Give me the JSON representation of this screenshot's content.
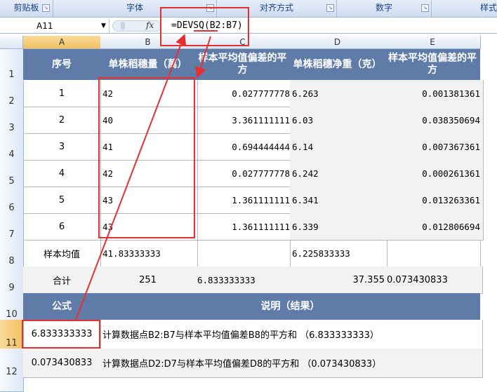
{
  "ribbon": {
    "groups": [
      "剪贴板",
      "字体",
      "对齐方式",
      "数字",
      "样式"
    ]
  },
  "formula_bar": {
    "name_box": "A11",
    "fx_label": "fx",
    "formula": "=DEVSQ(B2:B7)"
  },
  "columns": [
    "A",
    "B",
    "C",
    "D",
    "E"
  ],
  "rows": [
    "1",
    "2",
    "3",
    "4",
    "5",
    "6",
    "7",
    "8",
    "9",
    "10",
    "11",
    "12"
  ],
  "table": {
    "headers": [
      "序号",
      "单株稻穗量（萬）",
      "样本平均值偏差的平方",
      "单株稻穗净重（克）",
      "样本平均值偏差的平方"
    ],
    "data": [
      [
        "1",
        "42",
        "0.027777778",
        "6.263",
        "0.001381361"
      ],
      [
        "2",
        "40",
        "3.361111111",
        "6.03",
        "0.038350694"
      ],
      [
        "3",
        "41",
        "0.694444444",
        "6.14",
        "0.007367361"
      ],
      [
        "4",
        "42",
        "0.027777778",
        "6.242",
        "0.000261361"
      ],
      [
        "5",
        "43",
        "1.361111111",
        "6.341",
        "0.013263361"
      ],
      [
        "6",
        "43",
        "1.361111111",
        "6.339",
        "0.012806694"
      ]
    ],
    "mean_row": [
      "样本均值",
      "41.83333333",
      "",
      "6.225833333",
      ""
    ],
    "sum_row": [
      "合计",
      "251",
      "6.833333333",
      "37.355",
      "0.073430833"
    ],
    "explain_header": [
      "公式",
      "说明（结果）"
    ],
    "explain_rows": [
      [
        "6.833333333",
        "计算数据点B2:B7与样本平均值偏差B8的平方和 （6.833333333）"
      ],
      [
        "0.073430833",
        "计算数据点D2:D7与样本平均值偏差D8的平方和 （0.073430833）"
      ]
    ]
  },
  "colors": {
    "header_fill": "#5f7ca8",
    "annotation_red": "#e63030"
  }
}
